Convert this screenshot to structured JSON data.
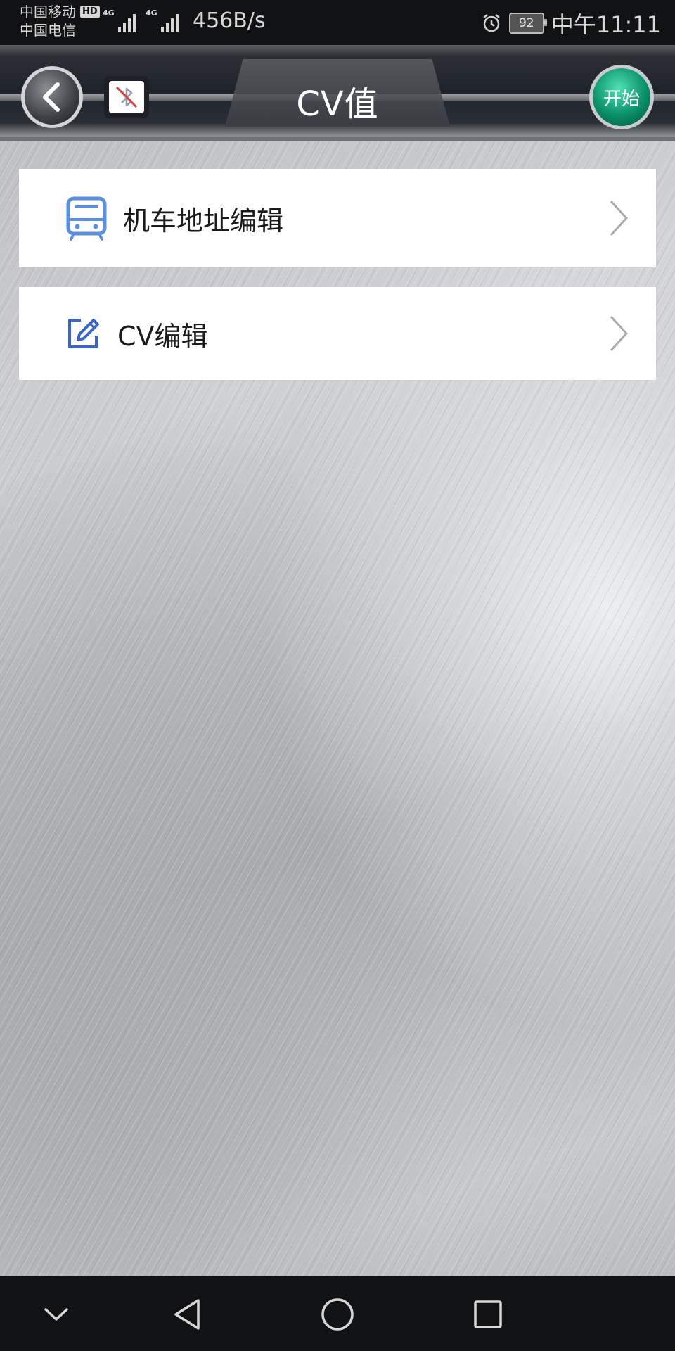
{
  "status_bar": {
    "carrier_1": "中国移动",
    "carrier_1_badge": "HD",
    "carrier_2": "中国电信",
    "network_1": "4G",
    "network_2": "4G",
    "net_speed": "456B/s",
    "battery_level": "92",
    "time": "中午11:11"
  },
  "header": {
    "title": "CV值",
    "start_label": "开始",
    "back_icon": "chevron-left-icon",
    "bluetooth_icon": "bluetooth-disabled-icon"
  },
  "menu": {
    "items": [
      {
        "label": "机车地址编辑",
        "icon": "train-icon"
      },
      {
        "label": "CV编辑",
        "icon": "edit-icon"
      }
    ]
  },
  "nav_bar": {
    "icons": [
      "collapse-icon",
      "back-triangle-icon",
      "home-circle-icon",
      "recents-square-icon"
    ]
  },
  "colors": {
    "status_bar_bg": "#111214",
    "nav_bar_bg": "#111214",
    "start_button": "#0a8f6a",
    "icon_accent": "#3a66c9"
  }
}
